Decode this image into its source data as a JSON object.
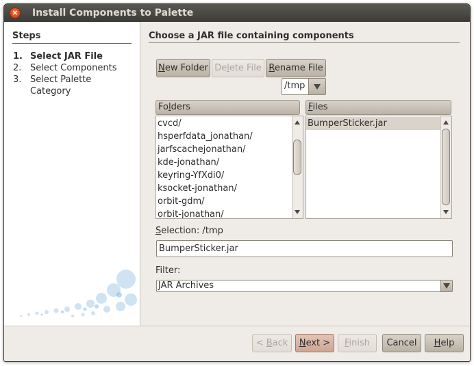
{
  "window": {
    "title": "Install Components to Palette"
  },
  "steps": {
    "title": "Steps",
    "items": [
      {
        "num": "1.",
        "label": "Select JAR File"
      },
      {
        "num": "2.",
        "label": "Select Components"
      },
      {
        "num": "3.",
        "label": "Select Palette"
      },
      {
        "num": "",
        "label": "Category"
      }
    ]
  },
  "panel": {
    "title": "Choose a JAR file containing components"
  },
  "toolbar": {
    "new_folder": {
      "mn": "N",
      "rest": "ew Folder"
    },
    "delete_file": {
      "pre": "De",
      "mn": "l",
      "rest": "ete File"
    },
    "rename_file": {
      "mn": "R",
      "rest": "ename File"
    }
  },
  "path_combo": {
    "value": "/tmp"
  },
  "folders": {
    "header_pre": "Fo",
    "header_mn": "l",
    "header_rest": "ders",
    "items": [
      "cvcd/",
      "hsperfdata_jonathan/",
      "jarfscachejonathan/",
      "kde-jonathan/",
      "keyring-YfXdi0/",
      "ksocket-jonathan/",
      "orbit-gdm/",
      "orbit-jonathan/"
    ]
  },
  "files": {
    "header_mn": "F",
    "header_rest": "iles",
    "items": [
      "BumperSticker.jar"
    ]
  },
  "selection": {
    "label_mn": "S",
    "label_rest": "election: /tmp",
    "value": "BumperSticker.jar"
  },
  "filter": {
    "label": "Filter:",
    "value": "JAR Archives"
  },
  "buttons": {
    "back": {
      "pre": "< ",
      "mn": "B",
      "rest": "ack"
    },
    "next": {
      "mn": "N",
      "rest": "ext >"
    },
    "finish": {
      "mn": "F",
      "rest": "inish"
    },
    "cancel": "Cancel",
    "help": {
      "mn": "H",
      "rest": "elp"
    }
  }
}
